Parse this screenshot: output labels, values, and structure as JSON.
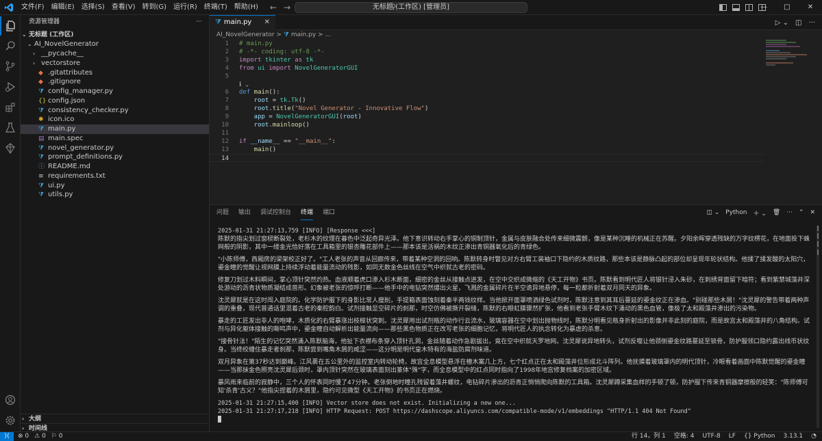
{
  "menus": [
    "文件(F)",
    "编辑(E)",
    "选择(S)",
    "查看(V)",
    "转到(G)",
    "运行(R)",
    "终端(T)",
    "帮助(H)"
  ],
  "command_center": "无标题 (工作区) [管理员]",
  "window_controls": {
    "minimize": "—",
    "maximize": "□",
    "close": "✕"
  },
  "sidebar": {
    "title": "资源管理器",
    "more": "···",
    "workspace": "无标题 (工作区)",
    "project": "AI_NovelGenerator",
    "items": [
      {
        "label": "__pycache__",
        "kind": "folder",
        "icon": "chevron-right-icon"
      },
      {
        "label": "vectorstore",
        "kind": "folder",
        "icon": "chevron-right-icon"
      },
      {
        "label": ".gitattributes",
        "kind": "file",
        "icon": "git-icon"
      },
      {
        "label": ".gitignore",
        "kind": "file",
        "icon": "git-icon"
      },
      {
        "label": "config_manager.py",
        "kind": "file",
        "icon": "python-icon"
      },
      {
        "label": "config.json",
        "kind": "file",
        "icon": "json-icon"
      },
      {
        "label": "consistency_checker.py",
        "kind": "file",
        "icon": "python-icon"
      },
      {
        "label": "icon.ico",
        "kind": "file",
        "icon": "image-icon"
      },
      {
        "label": "main.py",
        "kind": "file",
        "icon": "python-icon",
        "selected": true
      },
      {
        "label": "main.spec",
        "kind": "file",
        "icon": "file-icon"
      },
      {
        "label": "novel_generator.py",
        "kind": "file",
        "icon": "python-icon"
      },
      {
        "label": "prompt_definitions.py",
        "kind": "file",
        "icon": "python-icon"
      },
      {
        "label": "README.md",
        "kind": "file",
        "icon": "info-icon"
      },
      {
        "label": "requirements.txt",
        "kind": "file",
        "icon": "text-file-icon"
      },
      {
        "label": "ui.py",
        "kind": "file",
        "icon": "python-icon"
      },
      {
        "label": "utils.py",
        "kind": "file",
        "icon": "python-icon"
      }
    ],
    "outline": "大纲",
    "timeline": "时间线"
  },
  "editor": {
    "tab": "main.py",
    "tab_close": "✕",
    "breadcrumb": {
      "folder": "AI_NovelGenerator",
      "sep": ">",
      "file": "main.py",
      "rest": "> ..."
    },
    "lines": [
      [
        {
          "t": "# main.py",
          "c": "cm"
        }
      ],
      [
        {
          "t": "# -*- coding: utf-8 -*-",
          "c": "cm"
        }
      ],
      [
        {
          "t": "import",
          "c": "kw"
        },
        {
          "t": " tkinter ",
          "c": "cls"
        },
        {
          "t": "as",
          "c": "kw"
        },
        {
          "t": " tk",
          "c": "cls"
        }
      ],
      [
        {
          "t": "from",
          "c": "kw"
        },
        {
          "t": " ui ",
          "c": "cls"
        },
        {
          "t": "import",
          "c": "kw"
        },
        {
          "t": " NovelGeneratorGUI",
          "c": "cls"
        }
      ],
      [],
      [],
      [
        {
          "t": "def",
          "c": "def"
        },
        {
          "t": " main",
          "c": "fn"
        },
        {
          "t": "():",
          "c": "pl"
        }
      ],
      [
        {
          "t": "    root",
          "c": "var"
        },
        {
          "t": " = ",
          "c": "pl"
        },
        {
          "t": "tk",
          "c": "cls"
        },
        {
          "t": ".",
          "c": "pl"
        },
        {
          "t": "Tk",
          "c": "cls"
        },
        {
          "t": "()",
          "c": "pl"
        }
      ],
      [
        {
          "t": "    root",
          "c": "var"
        },
        {
          "t": ".",
          "c": "pl"
        },
        {
          "t": "title",
          "c": "fn"
        },
        {
          "t": "(",
          "c": "pl"
        },
        {
          "t": "\"Novel Generator - Innovative Flow\"",
          "c": "str"
        },
        {
          "t": ")",
          "c": "pl"
        }
      ],
      [
        {
          "t": "    app",
          "c": "var"
        },
        {
          "t": " = ",
          "c": "pl"
        },
        {
          "t": "NovelGeneratorGUI",
          "c": "cls"
        },
        {
          "t": "(",
          "c": "pl"
        },
        {
          "t": "root",
          "c": "var"
        },
        {
          "t": ")",
          "c": "pl"
        }
      ],
      [
        {
          "t": "    root",
          "c": "var"
        },
        {
          "t": ".",
          "c": "pl"
        },
        {
          "t": "mainloop",
          "c": "fn"
        },
        {
          "t": "()",
          "c": "pl"
        }
      ],
      [],
      [
        {
          "t": "if",
          "c": "kw"
        },
        {
          "t": " __name__",
          "c": "var"
        },
        {
          "t": " == ",
          "c": "pl"
        },
        {
          "t": "\"__main__\"",
          "c": "str"
        },
        {
          "t": ":",
          "c": "pl"
        }
      ],
      [
        {
          "t": "    main",
          "c": "fn"
        },
        {
          "t": "()",
          "c": "pl"
        }
      ],
      []
    ],
    "line_numbers": [
      "1",
      "2",
      "3",
      "4",
      "5",
      "",
      "6",
      "7",
      "8",
      "9",
      "10",
      "11",
      "12",
      "13",
      "14"
    ],
    "codelens": "ℹ ⌄"
  },
  "panel": {
    "tabs": [
      "问题",
      "输出",
      "调试控制台",
      "终端",
      "端口"
    ],
    "active_tab": "终端",
    "shell": "Python",
    "terminal": {
      "header1": "2025-01-31 21:27:13,759 [INFO] [Response <<<]",
      "paragraphs": [
        "陈默的指尖划过窗棂断裂处，老杉木的纹理在暮色中泛起奇异光泽。他下意识转动右手掌心的铜制顶针，金属与皮肤融合处传来细微震颤，像是某种沉睡的机械正在苏醒。夕阳余晖穿透残缺的万字纹楞花，在地面投下蛛网般的阴影，其中一缕金光恰好落在工具箱里的银杏雕花部件上——那本该是活祸的木纹正渗出青铜器氧化后的青绿色。",
        "\"小陈师傅，西厢房的梁架校正好了。\"工人老张的声音从回廊传来，带着某种空洞的回响。陈默转身时瞥见对方右臂工装袖口下隐约的木质纹路，那些本该是静脉凸起的部位却呈现年轮状结构。他揉了揉发酸的太阳穴，鎏金瞳的觉醒让视网膜上持续浮动着能量流动的残影，如同无数金色丝线在空气中织就古老的密码。",
        "修复刀划过木料瞬间，掌心顶针突然灼热。血液顺着虎口渗入杉木断面，细密的金丝从接触点迸发，在空中交织成微缩的《天工开物》书页。陈默看到明代匠人将银针浸入朱砂，在刺绣背面留下暗符；看到紫禁城藻井深处游动的沥青状物质凝结成兽形。幻象被老张的惊呼打断——他手中的电钻突然爆出火星，飞溅的金属碎片在半空诡异地悬停，每一粒都折射着双月同天的异象。",
        "沈灵犀就是在这时闯入庭院的。化学防护服下的身影比常人瘦削，手提箱表面蚀刻着秦半两钱纹样。当他掀开面罩喷洒绿色试剂时，陈默注意到其耳后蔓延的鎏金纹正在渗血。\"别碰那些木屑！\"沈灵犀的警告带着两种声调的重叠，现代普通话里混着古老的秦腔韵白。试剂接触显空碎片的刹那，时空仿佛被撕开裂缝，陈默的右眼虹膜骤然扩张，他看到老张手臂木纹下涌动的黑色血管，像极了太和殿藻井渗出的污染物。",
        "暴走的工匠发出非人的咆哮，木质化的右臂暴涨出枝桠状突刺。沈灵犀用出试剂瓶的动作行云流水，玻璃容器在空中划出抛物线时，陈默分明看见瓶身折射出的影像并非此刻的庭院，而是故宫太和殿藻井的八角结构。试剂与异化躯体接触的嘶鸣声中，鎏金瞳自动解析出能量流向——那些黑色物质正在改写老张的细胞记忆，将明代匠人的执念转化为暴虐的杀意。",
        "\"接骨针法！\"陌生的记忆突然涌入陈默脑海，他扯下衣襟布条穿入顶针孔洞，金丝随着动作急剧拔出，竟在空中织就天罗地网。沈灵犀说异地转头，试剂反噬让他颈侧鎏金纹路蔓延至锁骨，防护服领口隐约露出线币状纹身。当终绞缠住暴走者刹那，陈默尝到嘴角木屑的咸涩——这分明是明代皇木特有的海盐防腐剂味道。",
        "双月异象在第37秒达到巅峰。江风裹在五公里外的监控室内转动轮椅，故宫全息模型悬浮在檀木案几上方，七个红点正在太和殿藻井位形成北斗阵列。他抚摸着玻璃罩内的明代顶针，冷眼看着画面中陈默觉醒的鎏金瞳——当那抹金色照亮沈灵犀后颈时，罩内顶针突然在玻璃表面刻出篆体\"殊\"字，而全息模型中的红点同时指向了1998年地宫修复档案的加密区域。",
        "暴风雨来临前的寂静中，三个人的怀表同时慢了47分钟。老张倒地时瞳孔残留着藻井螺纹，电钻碎片渗出的沥青正悄悄爬向陈默的工具箱。沈灵犀蹲采集血样的手顿了顿，防护服下传来青铜器摩擦般的轻笑：\"陈师傅可知'杀青'古义？\"他指尖捏着的木屑里，隐约可见微型《天工开物》的书页正在燃烧。"
      ],
      "log1": "2025-01-31 21:27:15,400 [INFO] Vector store does not exist. Initializing a new one...",
      "log2": "2025-01-31 21:27:17,218 [INFO] HTTP Request: POST https://dashscope.aliyuncs.com/compatible-mode/v1/embeddings \"HTTP/1.1 404 Not Found\""
    }
  },
  "statusbar": {
    "remote": "⟩⟨",
    "errors": "⊗ 0",
    "warnings": "⚠ 0",
    "ports": "⚐ 0",
    "position": "行 14，列 1",
    "spaces": "空格: 4",
    "encoding": "UTF-8",
    "eol": "LF",
    "braces": "{}",
    "language": "Python",
    "version": "3.13.1",
    "bell": "🔔"
  },
  "colors": {
    "accent": "#0078d4",
    "bg_editor": "#1f1f1f",
    "bg_chrome": "#181818"
  }
}
